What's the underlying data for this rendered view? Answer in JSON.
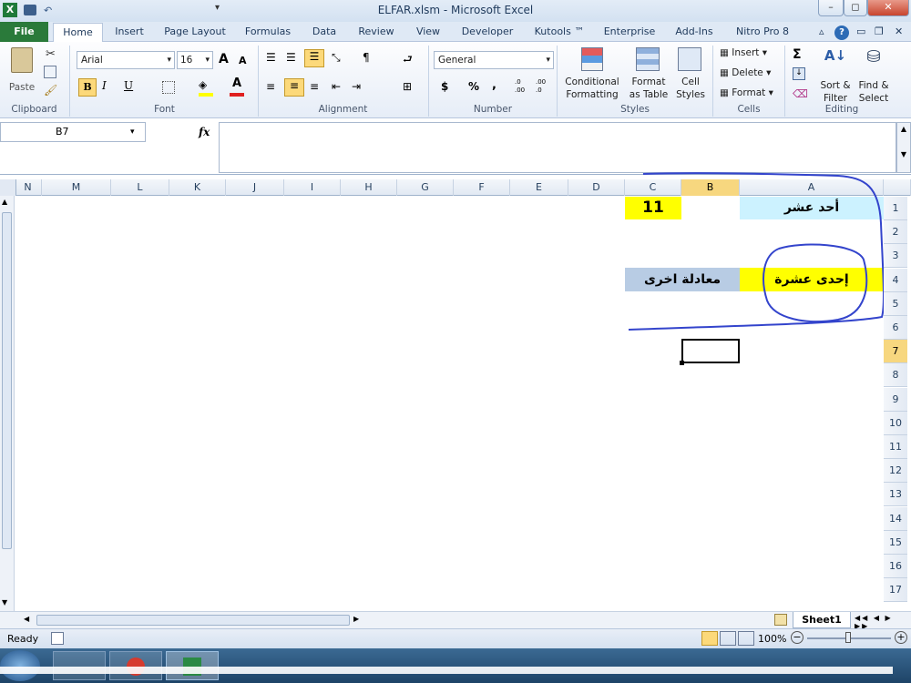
{
  "window": {
    "title": "ELFAR.xlsm  -  Microsoft Excel"
  },
  "tabs": [
    "File",
    "Home",
    "Insert",
    "Page Layout",
    "Formulas",
    "Data",
    "Review",
    "View",
    "Developer",
    "Kutools ™",
    "Enterprise",
    "Add-Ins",
    "Nitro Pro 8"
  ],
  "ribbon": {
    "clipboard": {
      "label": "Clipboard",
      "paste": "Paste"
    },
    "font": {
      "label": "Font",
      "name": "Arial",
      "size": "16",
      "bold": "B",
      "italic": "I",
      "underline": "U",
      "grow": "A",
      "shrink": "A"
    },
    "alignment": {
      "label": "Alignment"
    },
    "number": {
      "label": "Number",
      "format": "General",
      "currency": "$",
      "percent": "%",
      "comma": ",",
      "inc_dec": ".0 .00",
      "dec_dec": ".00 .0"
    },
    "styles": {
      "label": "Styles",
      "conditional_1": "Conditional",
      "conditional_2": "Formatting",
      "format_table_1": "Format",
      "format_table_2": "as Table",
      "cell_styles_1": "Cell",
      "cell_styles_2": "Styles"
    },
    "cells": {
      "label": "Cells",
      "insert": "Insert",
      "delete": "Delete",
      "format": "Format"
    },
    "editing": {
      "label": "Editing",
      "sum": "Σ",
      "sort_1": "Sort &",
      "sort_2": "Filter",
      "find_1": "Find &",
      "find_2": "Select"
    }
  },
  "formula_bar": {
    "name_box": "B7",
    "fx": "fx",
    "content": ""
  },
  "columns": [
    "N",
    "M",
    "L",
    "K",
    "J",
    "I",
    "H",
    "G",
    "F",
    "E",
    "D",
    "C",
    "B",
    "A"
  ],
  "rows": [
    "1",
    "2",
    "3",
    "4",
    "5",
    "6",
    "7",
    "8",
    "9",
    "10",
    "11",
    "12",
    "13",
    "14",
    "15",
    "16",
    "17"
  ],
  "cells": {
    "A1": "أحد عشر",
    "C1": "11",
    "A4": "إحدى عشرة",
    "C4": "معادلة اخرى"
  },
  "colors": {
    "yellow": "#ffff00",
    "light_cyan": "#ccf2ff",
    "steel_blue": "#b8cce4",
    "annotation": "#3344cc"
  },
  "sheet_tab": "Sheet1",
  "status": {
    "ready": "Ready",
    "zoom": "100%"
  }
}
